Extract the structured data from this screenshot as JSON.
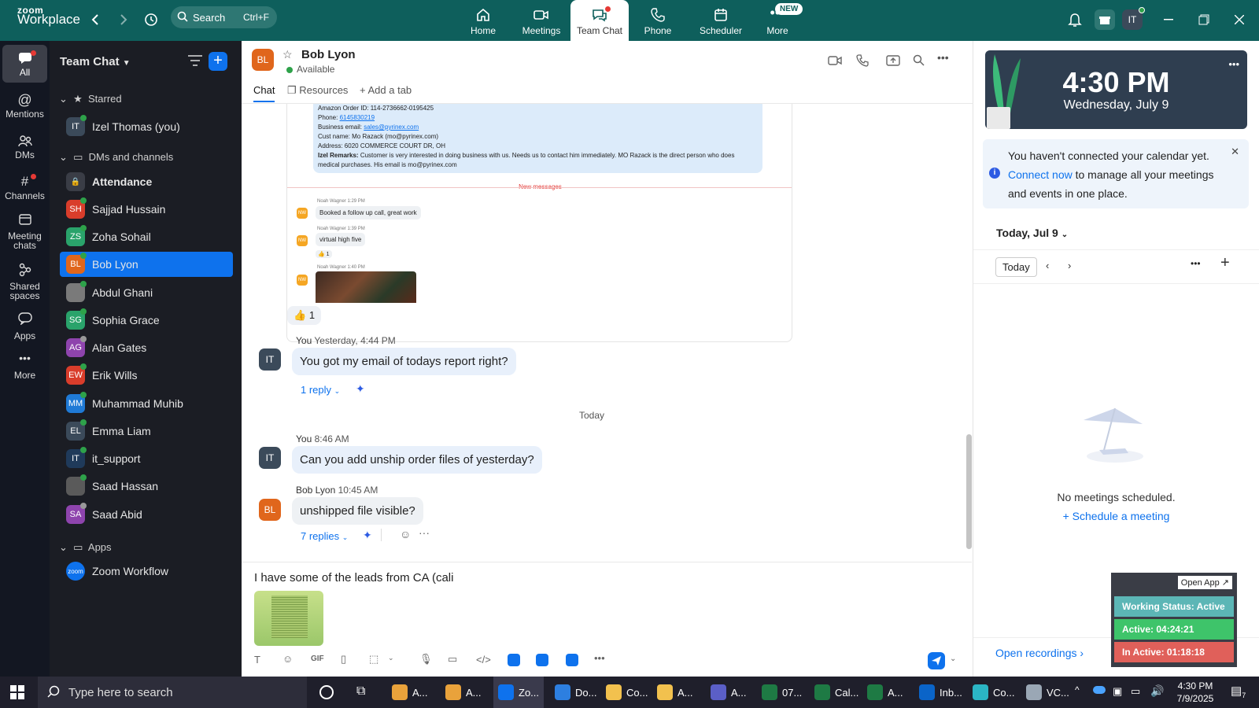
{
  "brand": {
    "line1": "zoom",
    "line2": "Workplace"
  },
  "search": {
    "label": "Search",
    "shortcut": "Ctrl+F"
  },
  "nav": {
    "tabs": [
      {
        "label": "Home"
      },
      {
        "label": "Meetings"
      },
      {
        "label": "Team Chat"
      },
      {
        "label": "Phone"
      },
      {
        "label": "Scheduler"
      },
      {
        "label": "More"
      }
    ],
    "new_badge": "NEW"
  },
  "user": {
    "initials": "IT"
  },
  "rail": {
    "items": [
      {
        "label": "All"
      },
      {
        "label": "Mentions"
      },
      {
        "label": "DMs"
      },
      {
        "label": "Channels"
      },
      {
        "label": "Meeting chats"
      },
      {
        "label": "Shared spaces"
      },
      {
        "label": "Apps"
      },
      {
        "label": "More"
      }
    ]
  },
  "sidebar": {
    "title": "Team Chat",
    "starred_label": "Starred",
    "dms_label": "DMs and channels",
    "apps_label": "Apps",
    "starred": [
      {
        "initials": "IT",
        "name": "Izel Thomas (you)",
        "color": "#3b4a5a",
        "status": "#2ea24a"
      }
    ],
    "contacts": [
      {
        "initials": "",
        "name": "Attendance",
        "color": "#3a3d46",
        "status": ""
      },
      {
        "initials": "SH",
        "name": "Sajjad Hussain",
        "color": "#d93d2b",
        "status": "#2ea24a"
      },
      {
        "initials": "ZS",
        "name": "Zoha Sohail",
        "color": "#2aa36b",
        "status": "#2ea24a"
      },
      {
        "initials": "BL",
        "name": "Bob Lyon",
        "color": "#e0661c",
        "status": "#2ea24a"
      },
      {
        "initials": "",
        "name": "Abdul Ghani",
        "color": "#7a7a7a",
        "status": "#2ea24a"
      },
      {
        "initials": "SG",
        "name": "Sophia Grace",
        "color": "#2aa36b",
        "status": "#2ea24a"
      },
      {
        "initials": "AG",
        "name": "Alan Gates",
        "color": "#8e44ad",
        "status": "#999999"
      },
      {
        "initials": "EW",
        "name": "Erik Wills",
        "color": "#d93d2b",
        "status": "#2ea24a"
      },
      {
        "initials": "MM",
        "name": "Muhammad Muhib",
        "color": "#1f7ad6",
        "status": "#2ea24a"
      },
      {
        "initials": "EL",
        "name": "Emma Liam",
        "color": "#3b4a5a",
        "status": "#2ea24a"
      },
      {
        "initials": "IT",
        "name": "it_support",
        "color": "#1f3a5a",
        "status": "#2ea24a"
      },
      {
        "initials": "",
        "name": "Saad Hassan",
        "color": "#5a5a5a",
        "status": "#2ea24a"
      },
      {
        "initials": "SA",
        "name": "Saad Abid",
        "color": "#8e44ad",
        "status": "#999999"
      }
    ],
    "apps": [
      {
        "initials": "zoom",
        "name": "Zoom Workflow",
        "color": "#0e72ed"
      }
    ]
  },
  "chat": {
    "contact_initials": "BL",
    "contact_name": "Bob Lyon",
    "contact_status": "Available",
    "tabs": {
      "chat": "Chat",
      "resources": "Resources",
      "add": "Add a tab"
    },
    "quoted": {
      "lines": [
        "Amazon Order ID: 114-2736662-0195425",
        "Phone: ",
        "Business email: ",
        "Cust name: Mo Razack (mo@pyrinex.com)",
        "Address: 6020 COMMERCE COURT DR, OH"
      ],
      "phone": "6145830219",
      "email": "sales@pyrinex.com",
      "remarks_label": "Izel Remarks:",
      "remarks": "Customer is very interested in doing business with us. Needs us to contact him immediately. MO Razack is the direct person who does medical purchases. His email is mo@pyrinex.com",
      "new_messages": "New messages",
      "msgs": [
        {
          "meta": "Noah Wagner 1:29 PM",
          "text": "Booked a follow up call, great work"
        },
        {
          "meta": "Noah Wagner 1:39 PM",
          "text": "virtual high five"
        },
        {
          "meta": "Noah Wagner 1:40 PM",
          "text": ""
        }
      ],
      "reaction": "👍 1",
      "initials": "NW"
    },
    "reaction_main": "1",
    "m1": {
      "sender": "You",
      "time": "Yesterday, 4:44 PM",
      "text": "You got my email of todays report right?",
      "replies": "1 reply"
    },
    "divider": "Today",
    "m2": {
      "sender": "You",
      "time": "8:46 AM",
      "text": "Can you add unship order files of yesterday?"
    },
    "m3": {
      "sender": "Bob Lyon",
      "time": "10:45 AM",
      "text": "unshipped file visible?",
      "replies": "7 replies"
    },
    "composer": "I have some of the leads from CA (cali"
  },
  "right": {
    "time": "4:30 PM",
    "date": "Wednesday, July 9",
    "notice_pre": "You haven't connected your calendar yet. ",
    "notice_link": "Connect now",
    "notice_post": " to manage all your meetings and events in one place.",
    "day_label": "Today, Jul 9",
    "today_btn": "Today",
    "empty": "No meetings scheduled.",
    "schedule": "Schedule a meeting",
    "recordings": "Open recordings"
  },
  "widget": {
    "open_app": "Open App",
    "working": "Working Status: Active",
    "active": "Active: 04:24:21",
    "inactive": "In Active: 01:18:18",
    "colors": {
      "working": "#5cb6b6",
      "active": "#3ec46a",
      "inactive": "#e0605a"
    }
  },
  "taskbar": {
    "search": "Type here to search",
    "apps": [
      {
        "icon": "chrome",
        "label": "A..."
      },
      {
        "icon": "chrome",
        "label": "A..."
      },
      {
        "icon": "zoom",
        "label": "Zo..."
      },
      {
        "icon": "download",
        "label": "Do..."
      },
      {
        "icon": "folder",
        "label": "Co..."
      },
      {
        "icon": "folder",
        "label": "A..."
      },
      {
        "icon": "teams",
        "label": "A..."
      },
      {
        "icon": "excel",
        "label": "07..."
      },
      {
        "icon": "excel",
        "label": "Cal..."
      },
      {
        "icon": "excel",
        "label": "A..."
      },
      {
        "icon": "outlook",
        "label": "Inb..."
      },
      {
        "icon": "edge",
        "label": "Co..."
      },
      {
        "icon": "vc",
        "label": "VC..."
      }
    ],
    "time": "4:30 PM",
    "date": "7/9/2025",
    "notif": "7"
  }
}
